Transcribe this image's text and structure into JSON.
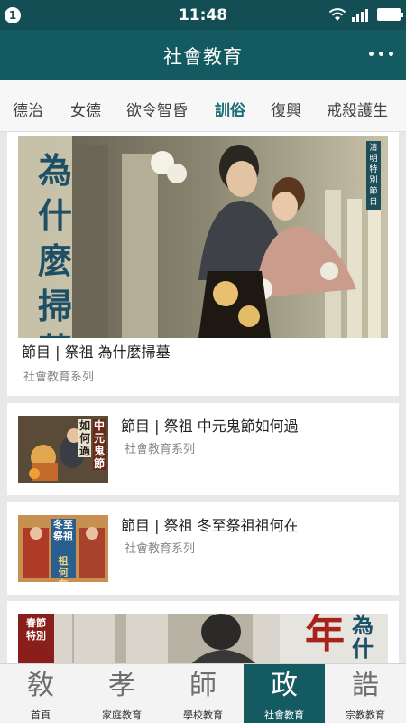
{
  "status_bar": {
    "badge": "1",
    "time": "11:48"
  },
  "header": {
    "title": "社會教育"
  },
  "tabs": [
    {
      "label": "德治"
    },
    {
      "label": "女德"
    },
    {
      "label": "欲令智昏"
    },
    {
      "label": "訓俗"
    },
    {
      "label": "復興"
    },
    {
      "label": "戒殺護生"
    }
  ],
  "feature": {
    "title": "節目 | 祭祖 為什麼掃墓",
    "subtitle": "社會教育系列",
    "image_text": "為什麼掃墓",
    "image_tag": "清明特別節目"
  },
  "items": [
    {
      "title": "節目 | 祭祖 中元鬼節如何過",
      "subtitle": "社會教育系列",
      "thumb_text_1": "中元鬼節",
      "thumb_text_2": "如何過"
    },
    {
      "title": "節目 | 祭祖 冬至祭祖祖何在",
      "subtitle": "社會教育系列",
      "thumb_text_1": "冬至祭祖",
      "thumb_text_2": "祖何在"
    }
  ],
  "partial": {
    "text_left": "春節特別",
    "text_right_1": "年",
    "text_right_2": "為什"
  },
  "bottom_nav": [
    {
      "label": "首頁",
      "glyph": "敎"
    },
    {
      "label": "家庭教育",
      "glyph": "孝"
    },
    {
      "label": "學校教育",
      "glyph": "師"
    },
    {
      "label": "社會教育",
      "glyph": "政"
    },
    {
      "label": "宗教教育",
      "glyph": "誥"
    }
  ],
  "colors": {
    "primary": "#135a61",
    "status": "#124e54",
    "accent": "#1a6d77"
  }
}
